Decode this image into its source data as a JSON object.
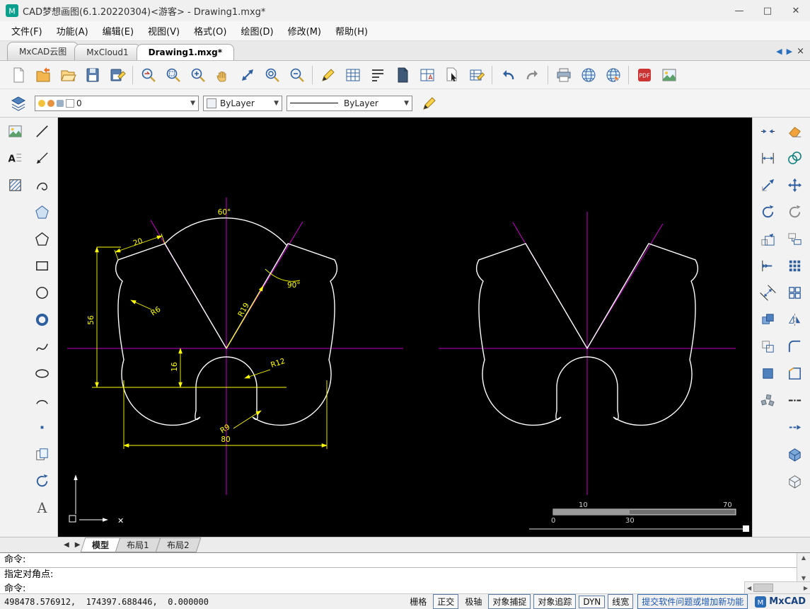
{
  "window": {
    "title": "CAD梦想画图(6.1.20220304)<游客> - Drawing1.mxg*",
    "controls": {
      "minimize": "—",
      "maximize": "□",
      "close": "✕"
    }
  },
  "menu": {
    "items": [
      "文件(F)",
      "功能(A)",
      "编辑(E)",
      "视图(V)",
      "格式(O)",
      "绘图(D)",
      "修改(M)",
      "帮助(H)"
    ]
  },
  "doc_tabs": {
    "items": [
      "MxCAD云图",
      "MxCloud1",
      "Drawing1.mxg*"
    ],
    "active": "Drawing1.mxg*"
  },
  "format_bar": {
    "layer": "0",
    "color": "ByLayer",
    "linetype": "ByLayer"
  },
  "icons": {
    "pdf_label": "PDF",
    "mtext_label": "A",
    "text_tool_label": "A",
    "brand_letter": "M"
  },
  "layout_bar": {
    "tabs": [
      "模型",
      "布局1",
      "布局2"
    ],
    "active": "模型"
  },
  "command_panel": {
    "lines": [
      "命令:",
      "指定对角点:",
      "命令:"
    ]
  },
  "status_bar": {
    "coordinates": "498478.576912,  174397.688446,  0.000000",
    "toggles": [
      {
        "label": "栅格",
        "boxed": false
      },
      {
        "label": "正交",
        "boxed": true
      },
      {
        "label": "极轴",
        "boxed": false
      },
      {
        "label": "对象捕捉",
        "boxed": true
      },
      {
        "label": "对象追踪",
        "boxed": true
      },
      {
        "label": "DYN",
        "boxed": true
      },
      {
        "label": "线宽",
        "boxed": true
      }
    ],
    "feedback_link": "提交软件问题或增加新功能",
    "brand": "MxCAD"
  },
  "canvas": {
    "colors": {
      "background": "#000000",
      "outline": "#ffffff",
      "centerline": "#c400c4",
      "dimension": "#ffff00"
    },
    "dimensions": {
      "top_angle": "60°",
      "edge_length": "20",
      "overall_height": "56",
      "notch_offset": "16",
      "overall_width": "80",
      "fillet_small": "R6",
      "radius_mid": "R19",
      "right_angle": "90°",
      "notch_radius": "R12",
      "fillet_bottom": "R9"
    },
    "scale_ruler": {
      "top_left": "10",
      "top_right": "70",
      "bottom_left": "0",
      "bottom_mid": "30"
    },
    "marker_x": "✕"
  }
}
